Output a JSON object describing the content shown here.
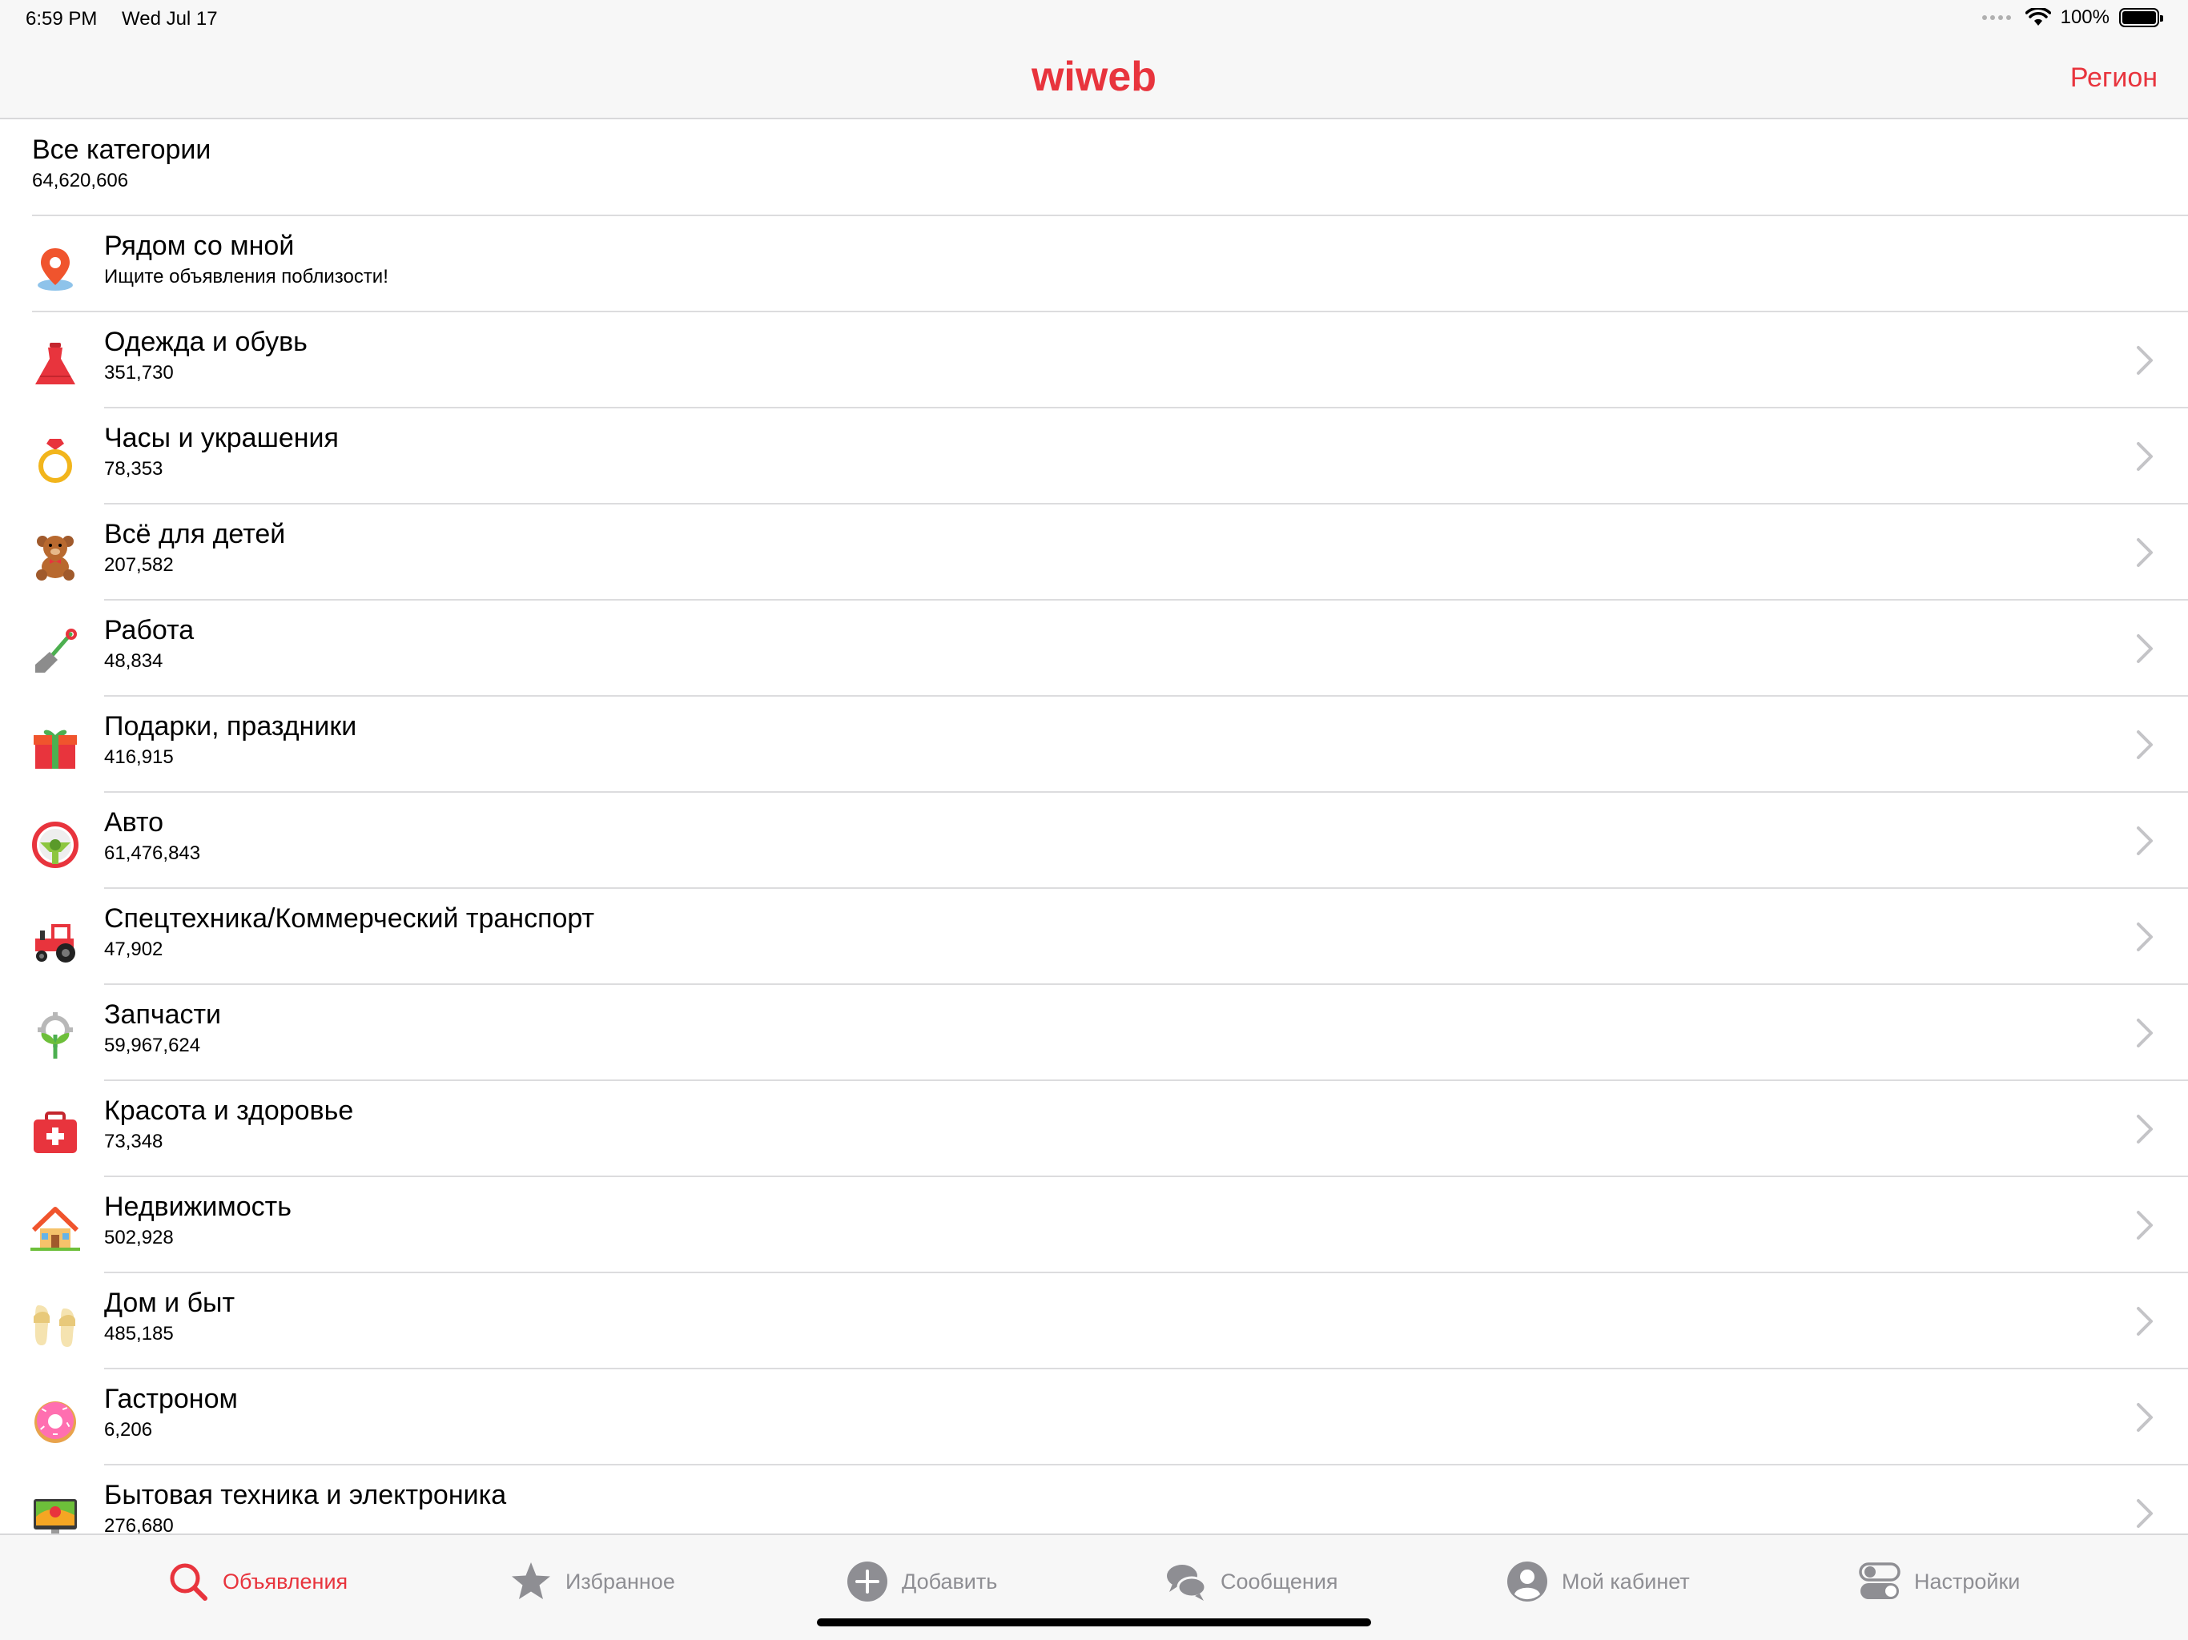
{
  "status": {
    "time": "6:59 PM",
    "date": "Wed Jul 17",
    "battery": "100%"
  },
  "nav": {
    "logo": "wiweb",
    "region": "Регион"
  },
  "header_row": {
    "title": "Все категории",
    "count": "64,620,606"
  },
  "categories": [
    {
      "title": "Рядом со мной",
      "subtitle": "Ищите объявления поблизости!",
      "icon": "location-pin-icon",
      "chevron": false
    },
    {
      "title": "Одежда и обувь",
      "subtitle": "351,730",
      "icon": "dress-icon",
      "chevron": true
    },
    {
      "title": "Часы и украшения",
      "subtitle": "78,353",
      "icon": "ring-icon",
      "chevron": true
    },
    {
      "title": "Всё для детей",
      "subtitle": "207,582",
      "icon": "teddy-bear-icon",
      "chevron": true
    },
    {
      "title": "Работа",
      "subtitle": "48,834",
      "icon": "shovel-icon",
      "chevron": true
    },
    {
      "title": "Подарки, праздники",
      "subtitle": "416,915",
      "icon": "gift-icon",
      "chevron": true
    },
    {
      "title": "Авто",
      "subtitle": "61,476,843",
      "icon": "steering-wheel-icon",
      "chevron": true
    },
    {
      "title": "Спецтехника/Коммерческий транспорт",
      "subtitle": "47,902",
      "icon": "tractor-icon",
      "chevron": true
    },
    {
      "title": "Запчасти",
      "subtitle": "59,967,624",
      "icon": "gear-plant-icon",
      "chevron": true
    },
    {
      "title": "Красота и здоровье",
      "subtitle": "73,348",
      "icon": "first-aid-kit-icon",
      "chevron": true
    },
    {
      "title": "Недвижимость",
      "subtitle": "502,928",
      "icon": "house-icon",
      "chevron": true
    },
    {
      "title": "Дом и быт",
      "subtitle": "485,185",
      "icon": "slippers-icon",
      "chevron": true
    },
    {
      "title": "Гастроном",
      "subtitle": "6,206",
      "icon": "donut-icon",
      "chevron": true
    },
    {
      "title": "Бытовая техника и электроника",
      "subtitle": "276,680",
      "icon": "monitor-icon",
      "chevron": true
    }
  ],
  "tabs": [
    {
      "label": "Объявления",
      "icon": "search-icon",
      "active": true
    },
    {
      "label": "Избранное",
      "icon": "star-icon",
      "active": false
    },
    {
      "label": "Добавить",
      "icon": "plus-circle-icon",
      "active": false
    },
    {
      "label": "Сообщения",
      "icon": "chat-bubbles-icon",
      "active": false
    },
    {
      "label": "Мой кабинет",
      "icon": "user-icon",
      "active": false
    },
    {
      "label": "Настройки",
      "icon": "toggles-icon",
      "active": false
    }
  ],
  "colors": {
    "accent": "#e8343d",
    "inactive_tab": "#8e8e93"
  }
}
